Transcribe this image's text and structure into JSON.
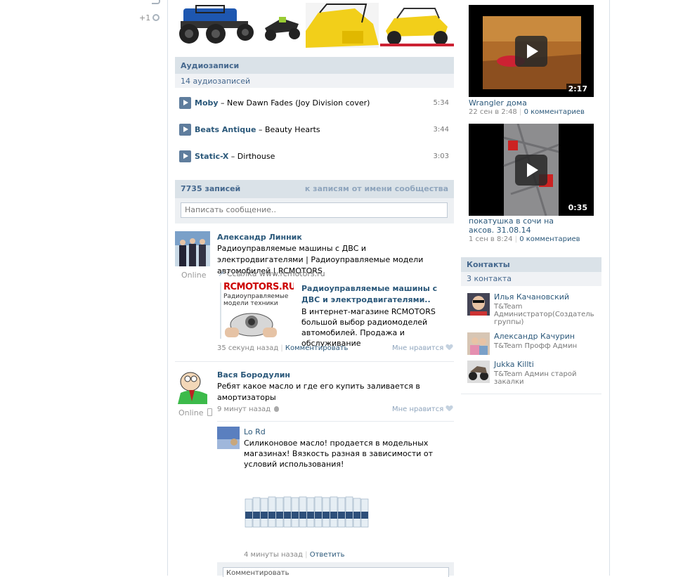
{
  "plusone": {
    "label": "+1"
  },
  "audio": {
    "title": "Аудиозаписи",
    "count": "14 аудиозаписей",
    "tracks": [
      {
        "artist": "Moby",
        "song": " – New Dawn Fades (Joy Division cover)",
        "duration": "5:34"
      },
      {
        "artist": "Beats Antique",
        "song": " – Beauty Hearts",
        "duration": "3:44"
      },
      {
        "artist": "Static-X",
        "song": " – Dirthouse",
        "duration": "3:03"
      }
    ]
  },
  "wall": {
    "count": "7735 записей",
    "community_link": "к записям от имени сообщества",
    "placeholder": "Написать сообщение.."
  },
  "posts": [
    {
      "author": "Александр Линник",
      "status": "Online",
      "text": "Радиоуправляемые машины с ДВС и электродвигателями | Радиоуправляемые модели автомобилей | RCMOTORS",
      "link_label": "Ссылка www.rcmotors.ru",
      "link_logo": "RCMOTORS.RU",
      "link_logo_sub": "Радиоуправляемые модели техники",
      "link_title": "Радиоуправляемые машины с ДВС и электродвигателями..",
      "link_desc": "В интернет-магазине RCMOTORS большой выбор радиомоделей автомобилей. Продажа и обслуживание",
      "time": "35 секунд назад",
      "comment": "Комментировать",
      "like": "Мне нравится"
    },
    {
      "author": "Вася Бородулин",
      "status": "Online",
      "text": "Ребят какое масло и где его купить заливается в амортизаторы",
      "time": "9 минут назад",
      "like": "Мне нравится"
    }
  ],
  "reply": {
    "author": "Lo Rd",
    "text": "Силиконовое масло! продается в модельных магазинах! Вязкость разная в зависимости от условий использования!",
    "time": "4 минуты назад",
    "reply_label": "Ответить",
    "comment_placeholder": "Комментировать"
  },
  "videos": [
    {
      "duration": "2:17",
      "title": "Wrangler дома",
      "date": "22 сен в 2:48",
      "comments": "0 комментариев"
    },
    {
      "duration": "0:35",
      "title": "покатушка в сочи на аксов. 31.08.14",
      "date": "1 сен в 8:24",
      "comments": "0 комментариев"
    }
  ],
  "contacts": {
    "title": "Контакты",
    "count": "3 контакта",
    "items": [
      {
        "name": "Илья Качановский",
        "role": "T&Team Администратор(Создатель группы)"
      },
      {
        "name": "Александр Качурин",
        "role": "T&Team Профф Админ"
      },
      {
        "name": "Jukka Killti",
        "role": "T&Team Админ старой закалки"
      }
    ]
  }
}
